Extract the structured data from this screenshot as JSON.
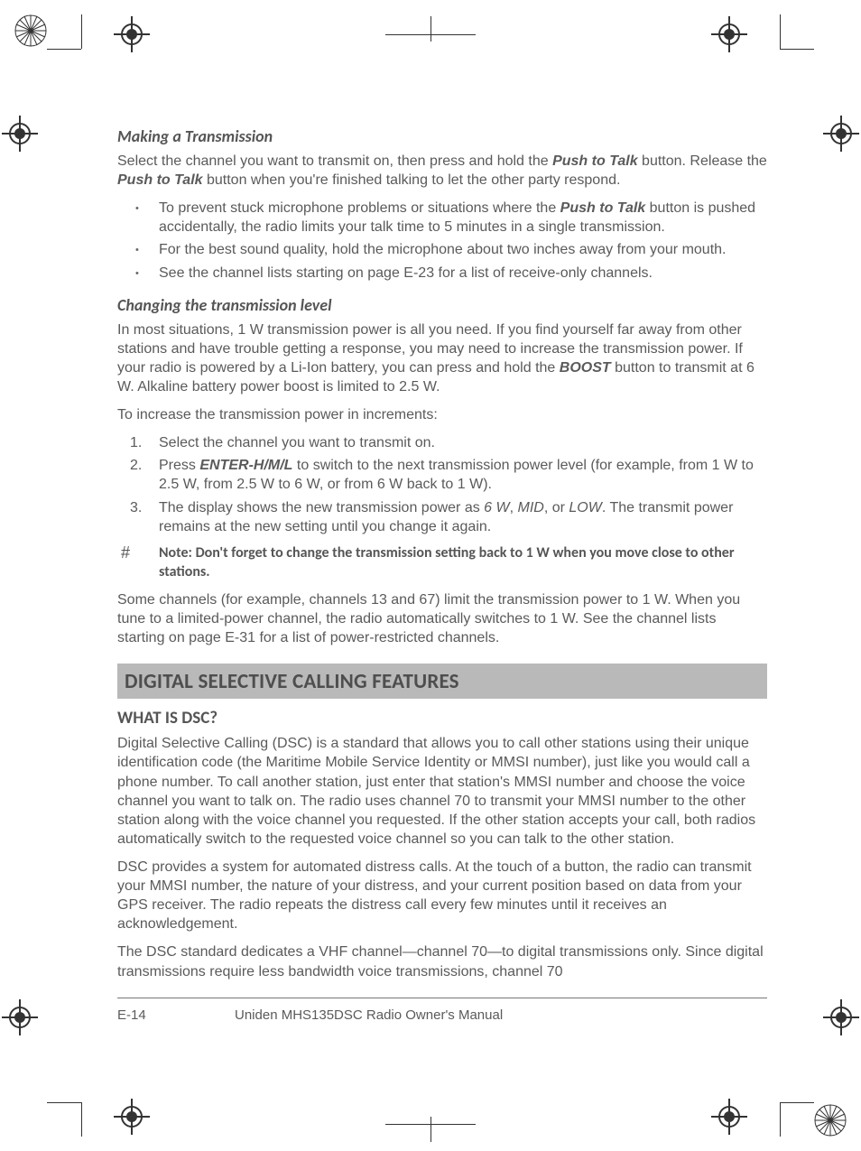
{
  "headings": {
    "making": "Making a Transmission",
    "changing": "Changing the transmission level",
    "section": "DIGITAL SELECTIVE CALLING FEATURES",
    "whatisdsc": "WHAT IS DSC?"
  },
  "making": {
    "p1_a": "Select the channel you want to transmit on, then press and hold the ",
    "p1_ptt1": "Push to Talk",
    "p1_b": " button. Release the ",
    "p1_ptt2": "Push to Talk",
    "p1_c": " button when you're finished talking to let the other party respond.",
    "b1_a": "To prevent stuck microphone problems or situations where the ",
    "b1_ptt": "Push to Talk",
    "b1_b": " button is pushed accidentally, the radio limits your talk time to 5 minutes in a single transmission.",
    "b2": "For the best sound quality, hold the microphone about two inches away from your mouth.",
    "b3": "See the channel lists starting on page E-23 for a list of receive-only channels."
  },
  "changing": {
    "p1_a": "In most situations, 1 W transmission power is all you need. If you find yourself far away from other stations and have trouble getting a response, you may need to increase the transmission power. If your radio is powered by a Li-Ion battery, you can press and hold the ",
    "p1_boost": "BOOST",
    "p1_b": " button to transmit at 6 W. Alkaline battery power boost is limited to 2.5 W.",
    "p2": "To increase the transmission power in increments:",
    "s1": "Select the channel you want to transmit on.",
    "s2_a": "Press ",
    "s2_btn": "ENTER-H/M/L",
    "s2_b": " to switch to the next transmission power level (for example, from 1 W to 2.5 W, from 2.5 W to 6 W, or from 6 W back to 1 W).",
    "s3_a": "The display shows the new transmission power as ",
    "s3_6w": "6 W",
    "s3_b": ", ",
    "s3_mid": "MID",
    "s3_c": ", or ",
    "s3_low": "LOW",
    "s3_d": ". The transmit power remains at the new setting until you change it again.",
    "note": "Note: Don't forget to change the transmission setting back to 1 W when you move close to other stations.",
    "p3": "Some channels (for example, channels 13 and 67) limit the transmission power to 1 W. When you tune to a limited-power channel, the radio automatically switches to 1 W. See the channel lists starting on page E-31 for a list of power-restricted channels."
  },
  "dsc": {
    "p1": "Digital Selective Calling (DSC) is a standard that allows you to call other stations using their unique identification code (the Maritime Mobile Service Identity or MMSI number), just like you would call a phone number. To call another station, just enter that station's MMSI number and choose the voice channel you want to talk on. The radio uses channel 70 to transmit your MMSI number to the other station along with the voice channel you requested. If the other station accepts your call, both radios automatically switch to the requested voice channel so you can talk to the other station.",
    "p2": "DSC provides a system for automated distress calls. At the touch of a button, the radio can transmit your MMSI number, the nature of your distress, and your current position based on data from your GPS receiver. The radio repeats the distress call every few minutes until it receives an acknowledgement.",
    "p3": "The DSC standard dedicates a VHF channel—channel 70—to digital transmissions only. Since digital transmissions require less bandwidth voice transmissions, channel 70"
  },
  "footer": {
    "page": "E-14",
    "title": "Uniden MHS135DSC Radio Owner's Manual"
  },
  "note_icon": "#"
}
